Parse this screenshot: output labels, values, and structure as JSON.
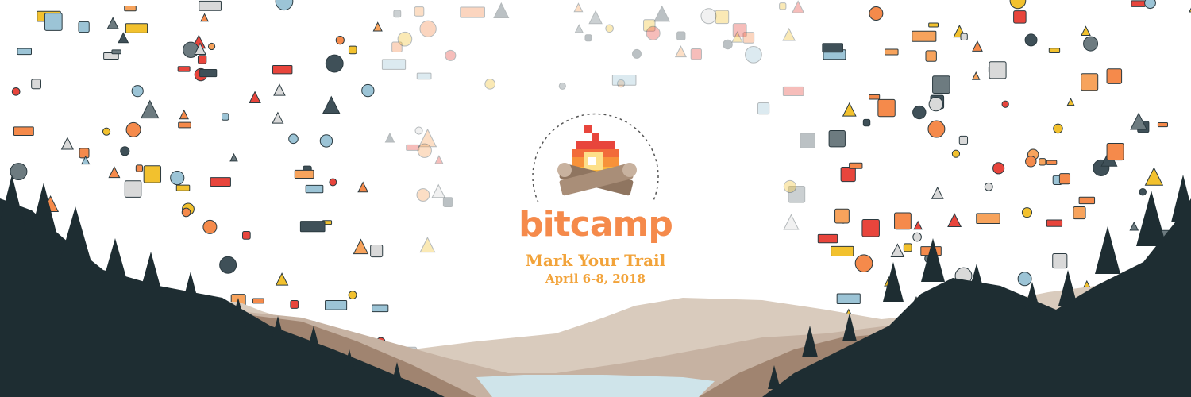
{
  "banner": {
    "brand": "bitcamp",
    "tagline": "Mark Your Trail",
    "dates": "April 6-8, 2018"
  },
  "colors": {
    "accent": "#f58a4b",
    "gold": "#f2a33a",
    "tree": "#1e2d32",
    "hill_near": "#a08470",
    "hill_far": "#d9cbbd",
    "lake": "#cfe4ea"
  },
  "icons": [
    "cd-disc-icon",
    "pizza-slice-icon",
    "floppy-disk-icon",
    "coin-icon",
    "computer-mouse-icon",
    "lightbulb-icon",
    "pencil-icon",
    "coffee-mug-icon",
    "tablet-icon",
    "keyboard-icon",
    "boxing-glove-icon",
    "paper-icon",
    "cookie-icon",
    "gamepad-icon"
  ]
}
